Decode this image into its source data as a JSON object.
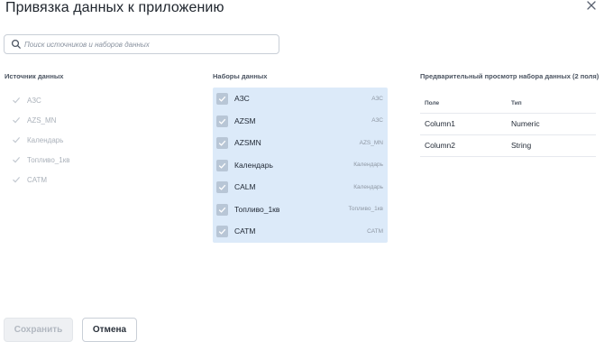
{
  "dialog": {
    "title": "Привязка данных к приложению"
  },
  "search": {
    "placeholder": "Поиск источников и наборов данных",
    "value": ""
  },
  "sources": {
    "header": "Источник данных",
    "items": [
      {
        "label": "АЗС"
      },
      {
        "label": "AZS_MN"
      },
      {
        "label": "Календарь"
      },
      {
        "label": "Топливо_1кв"
      },
      {
        "label": "CATM"
      }
    ]
  },
  "datasets": {
    "header": "Наборы данных",
    "items": [
      {
        "name": "АЗС",
        "source": "АЗС",
        "checked": true
      },
      {
        "name": "AZSM",
        "source": "АЗС",
        "checked": true
      },
      {
        "name": "AZSMN",
        "source": "AZS_MN",
        "checked": true
      },
      {
        "name": "Календарь",
        "source": "Календарь",
        "checked": true
      },
      {
        "name": "CALM",
        "source": "Календарь",
        "checked": true
      },
      {
        "name": "Топливо_1кв",
        "source": "Топливо_1кв",
        "checked": true
      },
      {
        "name": "CATM",
        "source": "CATM",
        "checked": true
      }
    ]
  },
  "preview": {
    "title": "Предварительный просмотр набора данных (2 поля)",
    "columns": [
      "Поле",
      "Тип"
    ],
    "rows": [
      [
        "Column1",
        "Numeric"
      ],
      [
        "Column2",
        "String"
      ]
    ]
  },
  "footer": {
    "save_label": "Сохранить",
    "cancel_label": "Отмена"
  },
  "colors": {
    "dataset_panel_bg": "#dceaf9",
    "disabled_text": "#aab1ba",
    "checkbox_fill": "#b8c6d6"
  }
}
